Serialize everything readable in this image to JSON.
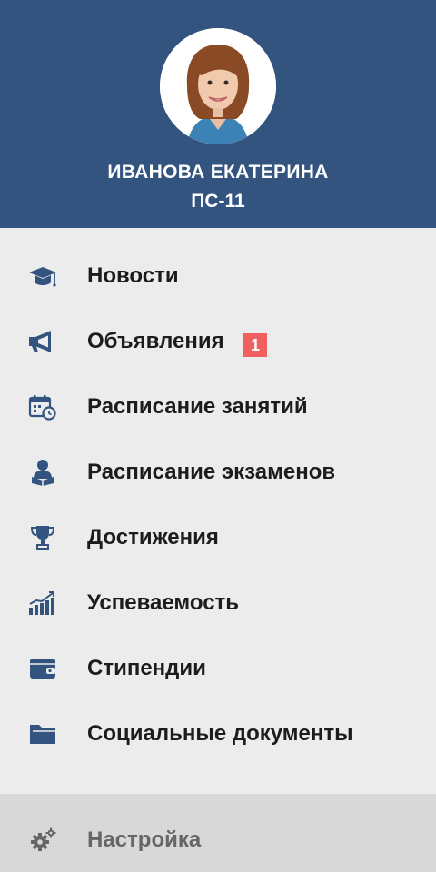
{
  "profile": {
    "name": "ИВАНОВА ЕКАТЕРИНА",
    "group": "ПС-11"
  },
  "menu": {
    "items": [
      {
        "label": "Новости",
        "icon": "graduation-cap-icon"
      },
      {
        "label": "Объявления",
        "icon": "megaphone-icon",
        "badge": "1"
      },
      {
        "label": "Расписание занятий",
        "icon": "calendar-clock-icon"
      },
      {
        "label": "Расписание экзаменов",
        "icon": "student-reading-icon"
      },
      {
        "label": "Достижения",
        "icon": "trophy-icon"
      },
      {
        "label": "Успеваемость",
        "icon": "bar-chart-icon"
      },
      {
        "label": "Стипендии",
        "icon": "wallet-icon"
      },
      {
        "label": "Социальные документы",
        "icon": "folder-icon"
      }
    ]
  },
  "footer": {
    "settings_label": "Настройка",
    "settings_icon": "gears-icon"
  },
  "colors": {
    "header_bg": "#33547f",
    "icon": "#33547f",
    "badge": "#f06060",
    "menu_bg": "#ececec",
    "footer_bg": "#d8d8d8"
  }
}
